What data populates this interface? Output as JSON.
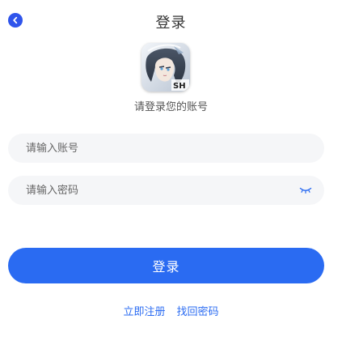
{
  "header": {
    "title": "登录"
  },
  "logo": {
    "badge_text": "SH"
  },
  "prompt": "请登录您的账号",
  "form": {
    "account_placeholder": "请输入账号",
    "password_placeholder": "请输入密码"
  },
  "login_button_label": "登录",
  "links": {
    "register": "立即注册",
    "forgot": "找回密码"
  },
  "colors": {
    "primary": "#2a6bf2",
    "back_button": "#2f54eb",
    "input_background": "#f5f6f8"
  },
  "icons": {
    "back": "chevron-left-icon",
    "password_visibility": "eye-closed-icon"
  }
}
